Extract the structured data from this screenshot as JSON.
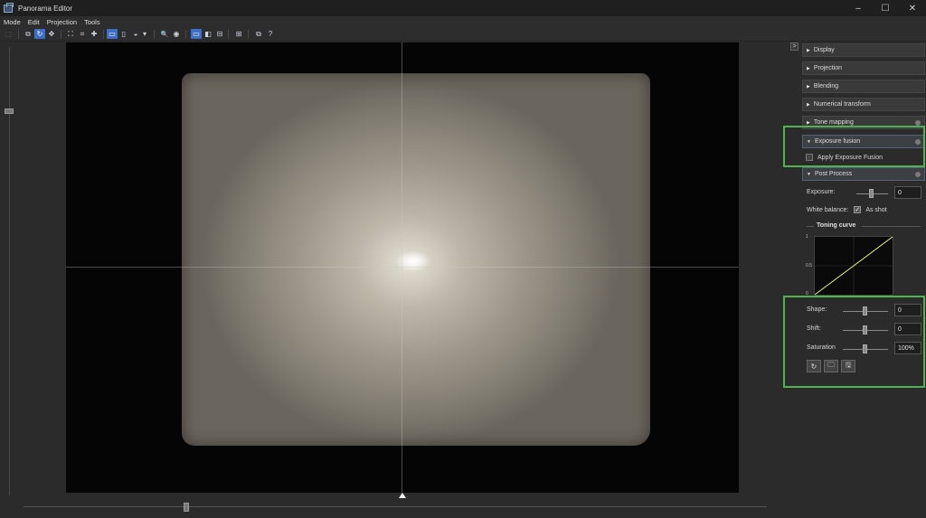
{
  "window": {
    "title": "Panorama Editor",
    "controls": {
      "minimize": "–",
      "maximize": "☐",
      "close": "✕"
    }
  },
  "menu": [
    "Mode",
    "Edit",
    "Projection",
    "Tools"
  ],
  "toolbar": {
    "buttons": [
      {
        "icon": "select-icon",
        "glyph": "⬚"
      },
      {
        "icon": "pan-icon",
        "glyph": "⧉"
      },
      {
        "icon": "rotate-icon",
        "glyph": "↻"
      },
      {
        "icon": "move-icon",
        "glyph": "✥"
      },
      {
        "icon": "fit-icon",
        "glyph": "⛶"
      },
      {
        "icon": "crop-icon",
        "glyph": "⌗"
      },
      {
        "icon": "center-icon",
        "glyph": "✚"
      },
      {
        "icon": "planar-icon",
        "glyph": "▭"
      },
      {
        "icon": "cylindrical-icon",
        "glyph": "▯"
      },
      {
        "icon": "spherical-icon",
        "glyph": "◒"
      },
      {
        "icon": "dropdown-icon",
        "glyph": "▾"
      },
      {
        "icon": "zoom-icon",
        "glyph": "🔍"
      },
      {
        "icon": "eye-icon",
        "glyph": "◉"
      },
      {
        "icon": "frame-icon",
        "glyph": "▭"
      },
      {
        "icon": "compare-icon",
        "glyph": "◧"
      },
      {
        "icon": "book-icon",
        "glyph": "⊟"
      },
      {
        "icon": "layers-icon",
        "glyph": "⊞"
      },
      {
        "icon": "copy-icon",
        "glyph": "⧉"
      },
      {
        "icon": "help-icon",
        "glyph": "?"
      }
    ]
  },
  "panel": {
    "collapse_glyph": ">",
    "sections": {
      "display": "Display",
      "projection": "Projection",
      "blending": "Blending",
      "numerical_transform": "Numerical transform",
      "tone_mapping": "Tone mapping",
      "exposure_fusion": "Exposure fusion",
      "post_process": "Post Process"
    },
    "apply_exposure_fusion": "Apply Exposure Fusion",
    "exposure": {
      "label": "Exposure:",
      "value": "0"
    },
    "white_balance": {
      "label": "White balance:",
      "option": "As shot",
      "checked": true
    },
    "toning_curve": {
      "title": "Toning curve",
      "ticks": [
        "1",
        "0.5",
        "0"
      ]
    },
    "shape": {
      "label": "Shape:",
      "value": "0"
    },
    "shift": {
      "label": "Shift:",
      "value": "0"
    },
    "saturation": {
      "label": "Saturation",
      "value": "100%"
    },
    "actions": [
      {
        "icon": "reset-icon",
        "glyph": "↻"
      },
      {
        "icon": "open-folder-icon",
        "glyph": "🗀"
      },
      {
        "icon": "save-icon",
        "glyph": "🖫"
      }
    ]
  },
  "colors": {
    "highlight": "#4fb34f",
    "accent": "#3d6fc6",
    "curve": "#e6ef7a"
  }
}
